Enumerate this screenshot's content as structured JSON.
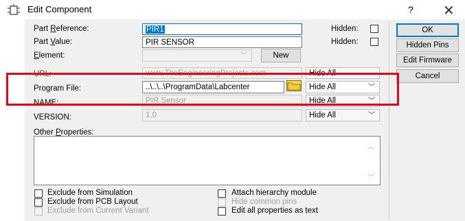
{
  "window": {
    "title": "Edit Component",
    "help_label": "?",
    "close_label": "✕"
  },
  "labels": {
    "part_reference": "Part Reference:",
    "part_value": "Part Value:",
    "element": "Element:",
    "url": "URL:",
    "program_file": "Program File:",
    "name": "NAME:",
    "version": "VERSION:",
    "other_properties": "Other Properties:",
    "hidden": "Hidden:"
  },
  "fields": {
    "part_reference": "PIR1",
    "part_value": "PIR SENSOR",
    "url": "www.TheEngineeringProjects.com",
    "program_file": "..\\..\\..\\ProgramData\\Labcenter",
    "name": "PIR Sensor",
    "version": "1.0"
  },
  "selects": {
    "url_visibility": "Hide All",
    "program_file_visibility": "Hide All",
    "name_visibility": "Hide All",
    "version_visibility": "Hide All"
  },
  "buttons": {
    "new": "New",
    "ok": "OK",
    "hidden_pins": "Hidden Pins",
    "edit_firmware": "Edit Firmware",
    "cancel": "Cancel"
  },
  "checkboxes": {
    "exclude_simulation": "Exclude from Simulation",
    "exclude_pcb": "Exclude from PCB Layout",
    "exclude_variant": "Exclude from Current Variant",
    "attach_hierarchy": "Attach hierarchy module",
    "hide_common_pins": "Hide common pins",
    "edit_all_as_text": "Edit all properties as text"
  },
  "colors": {
    "highlight_box": "#e30613",
    "selection": "#0078d7"
  }
}
